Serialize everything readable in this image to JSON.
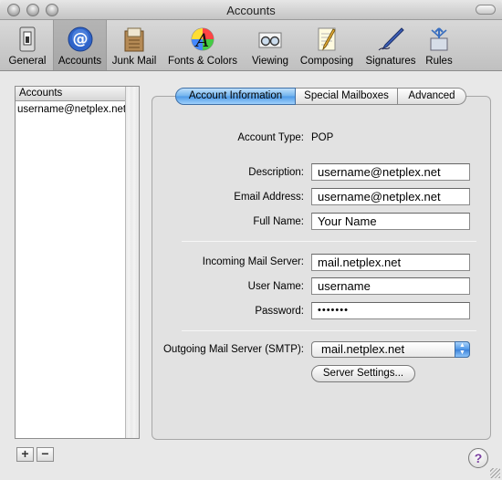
{
  "window": {
    "title": "Accounts"
  },
  "toolbar": {
    "items": [
      {
        "label": "General",
        "icon": "general-switch-icon"
      },
      {
        "label": "Accounts",
        "icon": "at-sign-icon",
        "selected": true
      },
      {
        "label": "Junk Mail",
        "icon": "junk-mail-icon"
      },
      {
        "label": "Fonts & Colors",
        "icon": "fonts-colors-icon"
      },
      {
        "label": "Viewing",
        "icon": "glasses-icon"
      },
      {
        "label": "Composing",
        "icon": "notepad-pencil-icon"
      },
      {
        "label": "Signatures",
        "icon": "pen-icon"
      },
      {
        "label": "Rules",
        "icon": "rules-arrows-icon"
      }
    ]
  },
  "accounts": {
    "header": "Accounts",
    "items": [
      "username@netplex.net"
    ],
    "add_label": "+",
    "remove_label": "−"
  },
  "tabs": [
    {
      "label": "Account Information",
      "active": true
    },
    {
      "label": "Special Mailboxes",
      "active": false
    },
    {
      "label": "Advanced",
      "active": false
    }
  ],
  "form": {
    "account_type_label": "Account Type:",
    "account_type_value": "POP",
    "description_label": "Description:",
    "description_value": "username@netplex.net",
    "email_label": "Email Address:",
    "email_value": "username@netplex.net",
    "fullname_label": "Full Name:",
    "fullname_value": "Your Name",
    "incoming_label": "Incoming Mail Server:",
    "incoming_value": "mail.netplex.net",
    "username_label": "User Name:",
    "username_value": "username",
    "password_label": "Password:",
    "password_value": "•••••••",
    "smtp_label": "Outgoing Mail Server (SMTP):",
    "smtp_value": "mail.netplex.net",
    "server_settings_label": "Server Settings..."
  },
  "help": {
    "label": "?"
  },
  "colors": {
    "accent": "#4d9ae8",
    "help": "#7a3fa0"
  }
}
